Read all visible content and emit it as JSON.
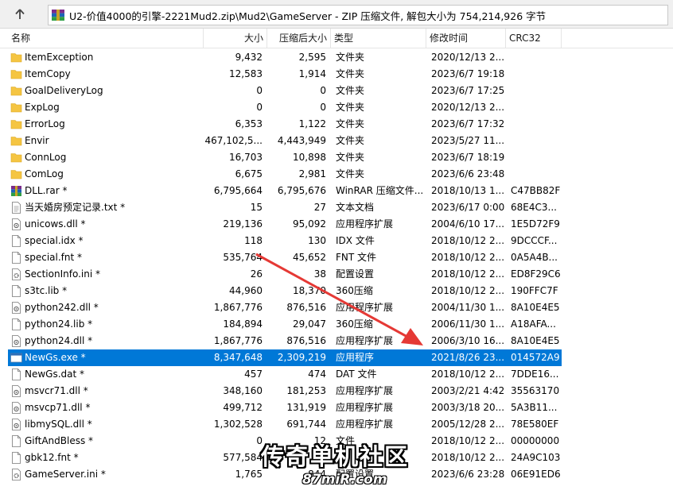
{
  "address_bar": {
    "path": "U2-价值4000的引擎-2221Mud2.zip\\Mud2\\GameServer - ZIP 压缩文件, 解包大小为 754,214,926 字节"
  },
  "columns": {
    "name": "名称",
    "size": "大小",
    "packed": "压缩后大小",
    "type": "类型",
    "modified": "修改时间",
    "crc": "CRC32"
  },
  "files": [
    {
      "name": "ItemException",
      "size": "9,432",
      "packed": "2,595",
      "type": "文件夹",
      "modified": "2020/12/13 2...",
      "crc": "",
      "icon": "folder-icon"
    },
    {
      "name": "ItemCopy",
      "size": "12,583",
      "packed": "1,914",
      "type": "文件夹",
      "modified": "2023/6/7 19:18",
      "crc": "",
      "icon": "folder-icon"
    },
    {
      "name": "GoalDeliveryLog",
      "size": "0",
      "packed": "0",
      "type": "文件夹",
      "modified": "2023/6/7 17:25",
      "crc": "",
      "icon": "folder-icon"
    },
    {
      "name": "ExpLog",
      "size": "0",
      "packed": "0",
      "type": "文件夹",
      "modified": "2020/12/13 2...",
      "crc": "",
      "icon": "folder-icon"
    },
    {
      "name": "ErrorLog",
      "size": "6,353",
      "packed": "1,122",
      "type": "文件夹",
      "modified": "2023/6/7 17:32",
      "crc": "",
      "icon": "folder-icon"
    },
    {
      "name": "Envir",
      "size": "467,102,5...",
      "packed": "4,443,949",
      "type": "文件夹",
      "modified": "2023/5/27 11...",
      "crc": "",
      "icon": "folder-icon"
    },
    {
      "name": "ConnLog",
      "size": "16,703",
      "packed": "10,898",
      "type": "文件夹",
      "modified": "2023/6/7 18:19",
      "crc": "",
      "icon": "folder-icon"
    },
    {
      "name": "ComLog",
      "size": "6,675",
      "packed": "2,981",
      "type": "文件夹",
      "modified": "2023/6/6 23:48",
      "crc": "",
      "icon": "folder-icon"
    },
    {
      "name": "DLL.rar *",
      "size": "6,795,664",
      "packed": "6,795,676",
      "type": "WinRAR 压缩文件...",
      "modified": "2018/10/13 1...",
      "crc": "C47BB82F",
      "icon": "rar-archive-icon"
    },
    {
      "name": "当天婚房预定记录.txt *",
      "size": "15",
      "packed": "27",
      "type": "文本文档",
      "modified": "2023/6/17 0:00",
      "crc": "68E4C3...",
      "icon": "text-file-icon"
    },
    {
      "name": "unicows.dll *",
      "size": "219,136",
      "packed": "95,092",
      "type": "应用程序扩展",
      "modified": "2004/6/10 17...",
      "crc": "1E5D72F9",
      "icon": "dll-file-icon"
    },
    {
      "name": "special.idx *",
      "size": "118",
      "packed": "130",
      "type": "IDX 文件",
      "modified": "2018/10/12 2...",
      "crc": "9DCCCF...",
      "icon": "blank-file-icon"
    },
    {
      "name": "special.fnt *",
      "size": "535,764",
      "packed": "45,652",
      "type": "FNT 文件",
      "modified": "2018/10/12 2...",
      "crc": "0A5A4B...",
      "icon": "blank-file-icon"
    },
    {
      "name": "SectionInfo.ini *",
      "size": "26",
      "packed": "38",
      "type": "配置设置",
      "modified": "2018/10/12 2...",
      "crc": "ED8F29C6",
      "icon": "ini-file-icon"
    },
    {
      "name": "s3tc.lib *",
      "size": "44,960",
      "packed": "18,370",
      "type": "360压缩",
      "modified": "2018/10/12 2...",
      "crc": "190FFC7F",
      "icon": "blank-file-icon"
    },
    {
      "name": "python242.dll *",
      "size": "1,867,776",
      "packed": "876,516",
      "type": "应用程序扩展",
      "modified": "2004/11/30 1...",
      "crc": "8A10E4E5",
      "icon": "dll-file-icon"
    },
    {
      "name": "python24.lib *",
      "size": "184,894",
      "packed": "29,047",
      "type": "360压缩",
      "modified": "2006/11/30 1...",
      "crc": "A18AFA...",
      "icon": "blank-file-icon"
    },
    {
      "name": "python24.dll *",
      "size": "1,867,776",
      "packed": "876,516",
      "type": "应用程序扩展",
      "modified": "2006/3/10 16...",
      "crc": "8A10E4E5",
      "icon": "dll-file-icon"
    },
    {
      "name": "NewGs.exe *",
      "size": "8,347,648",
      "packed": "2,309,219",
      "type": "应用程序",
      "modified": "2021/8/26 23...",
      "crc": "014572A9",
      "icon": "exe-file-icon",
      "selected": true
    },
    {
      "name": "NewGs.dat *",
      "size": "457",
      "packed": "474",
      "type": "DAT 文件",
      "modified": "2018/10/12 2...",
      "crc": "7DDE16...",
      "icon": "blank-file-icon"
    },
    {
      "name": "msvcr71.dll *",
      "size": "348,160",
      "packed": "181,253",
      "type": "应用程序扩展",
      "modified": "2003/2/21 4:42",
      "crc": "35563170",
      "icon": "dll-file-icon"
    },
    {
      "name": "msvcp71.dll *",
      "size": "499,712",
      "packed": "131,919",
      "type": "应用程序扩展",
      "modified": "2003/3/18 20...",
      "crc": "5A3B11...",
      "icon": "dll-file-icon"
    },
    {
      "name": "libmySQL.dll *",
      "size": "1,302,528",
      "packed": "691,744",
      "type": "应用程序扩展",
      "modified": "2005/12/28 2...",
      "crc": "78E580EF",
      "icon": "dll-file-icon"
    },
    {
      "name": "GiftAndBless *",
      "size": "0",
      "packed": "12",
      "type": "文件",
      "modified": "2018/10/12 2...",
      "crc": "00000000",
      "icon": "blank-file-icon"
    },
    {
      "name": "gbk12.fnt *",
      "size": "577,584",
      "packed": "",
      "type": "",
      "modified": "2018/10/12 2...",
      "crc": "24A9C103",
      "icon": "blank-file-icon"
    },
    {
      "name": "GameServer.ini *",
      "size": "1,765",
      "packed": "844",
      "type": "配置设置",
      "modified": "2023/6/6 23:28",
      "crc": "06E91ED6",
      "icon": "ini-file-icon"
    }
  ],
  "watermark": {
    "title": "传奇单机社区",
    "site": "87miR.com"
  },
  "colors": {
    "selection": "#0078d7",
    "folder": "#f5c542",
    "arrow": "#e53935"
  }
}
